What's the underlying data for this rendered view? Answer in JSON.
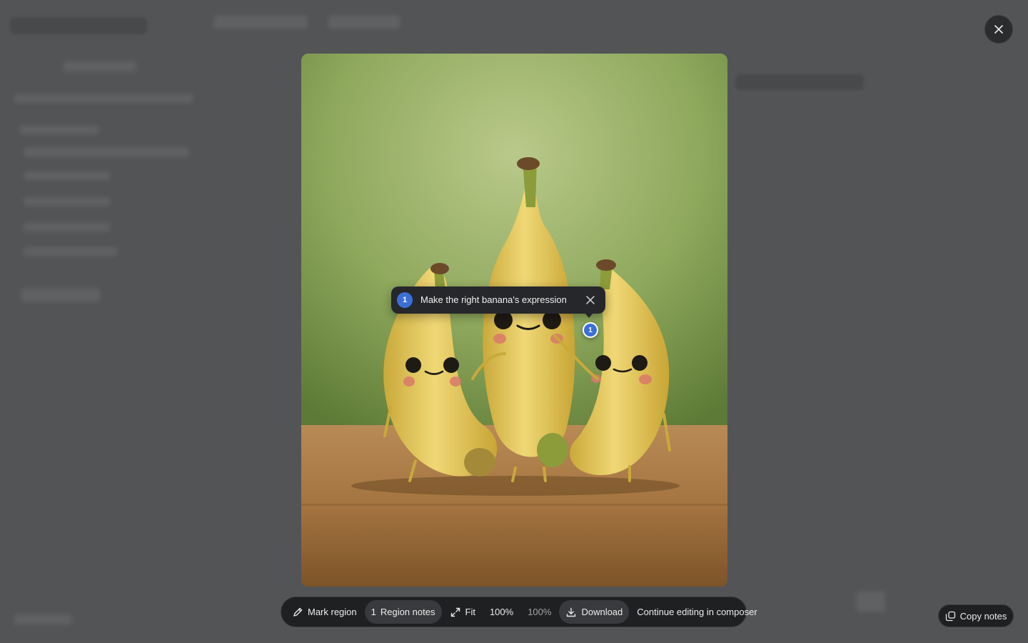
{
  "modal": {
    "close_icon": "close-icon"
  },
  "image": {
    "colors": {
      "background": "#9db46a",
      "table": "#a97c49",
      "banana": "#e3c95a"
    }
  },
  "annotation": {
    "number": "1",
    "text": "Make the right banana's expression",
    "close_icon": "close-icon",
    "accent": "#3b6fd8"
  },
  "toolbar": {
    "mark_region": "Mark region",
    "region_notes_count": "1",
    "region_notes": "Region notes",
    "fit": "Fit",
    "zoom": "100%",
    "zoom_secondary": "100%",
    "download": "Download",
    "continue": "Continue editing in composer"
  },
  "copy_notes": {
    "label": "Copy notes"
  }
}
